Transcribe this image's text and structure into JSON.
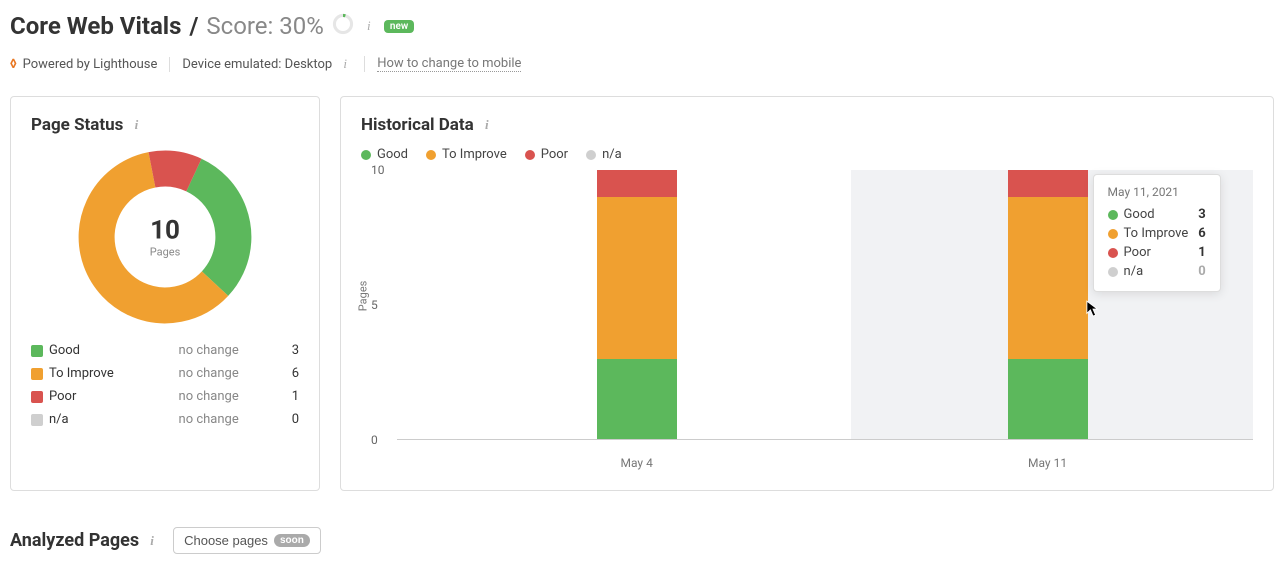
{
  "header": {
    "title": "Core Web Vitals",
    "sep": "/",
    "score_label": "Score:",
    "score_pct": "30%",
    "badge": "new"
  },
  "meta": {
    "powered_label": "Powered by Lighthouse",
    "device_label": "Device emulated: Desktop",
    "how_link": "How to change to mobile"
  },
  "colors": {
    "good": "#5cb85c",
    "improve": "#f0a030",
    "poor": "#d9534f",
    "na": "#cfcfcf"
  },
  "page_status": {
    "title": "Page Status",
    "total": "10",
    "total_label": "Pages",
    "legend": [
      {
        "name": "Good",
        "change": "no change",
        "value": "3"
      },
      {
        "name": "To Improve",
        "change": "no change",
        "value": "6"
      },
      {
        "name": "Poor",
        "change": "no change",
        "value": "1"
      },
      {
        "name": "n/a",
        "change": "no change",
        "value": "0"
      }
    ]
  },
  "historical": {
    "title": "Historical Data",
    "ylabel": "Pages",
    "legend": {
      "good": "Good",
      "improve": "To Improve",
      "poor": "Poor",
      "na": "n/a"
    },
    "yticks": [
      "10",
      "5",
      "0"
    ],
    "xcats": [
      "May 4",
      "May 11"
    ],
    "tooltip": {
      "date": "May 11, 2021",
      "rows": [
        {
          "name": "Good",
          "value": "3"
        },
        {
          "name": "To Improve",
          "value": "6"
        },
        {
          "name": "Poor",
          "value": "1"
        },
        {
          "name": "n/a",
          "value": "0"
        }
      ]
    }
  },
  "analyzed": {
    "title": "Analyzed Pages",
    "choose_label": "Choose pages",
    "soon": "soon"
  },
  "chart_data": {
    "type": "bar",
    "title": "Historical Data",
    "ylabel": "Pages",
    "ylim": [
      0,
      10
    ],
    "categories": [
      "May 4",
      "May 11"
    ],
    "series": [
      {
        "name": "Good",
        "values": [
          3,
          3
        ]
      },
      {
        "name": "To Improve",
        "values": [
          6,
          6
        ]
      },
      {
        "name": "Poor",
        "values": [
          1,
          1
        ]
      },
      {
        "name": "n/a",
        "values": [
          0,
          0
        ]
      }
    ],
    "donut": {
      "title": "Page Status",
      "type": "pie",
      "labels": [
        "Good",
        "To Improve",
        "Poor",
        "n/a"
      ],
      "values": [
        3,
        6,
        1,
        0
      ],
      "total": 10
    }
  }
}
